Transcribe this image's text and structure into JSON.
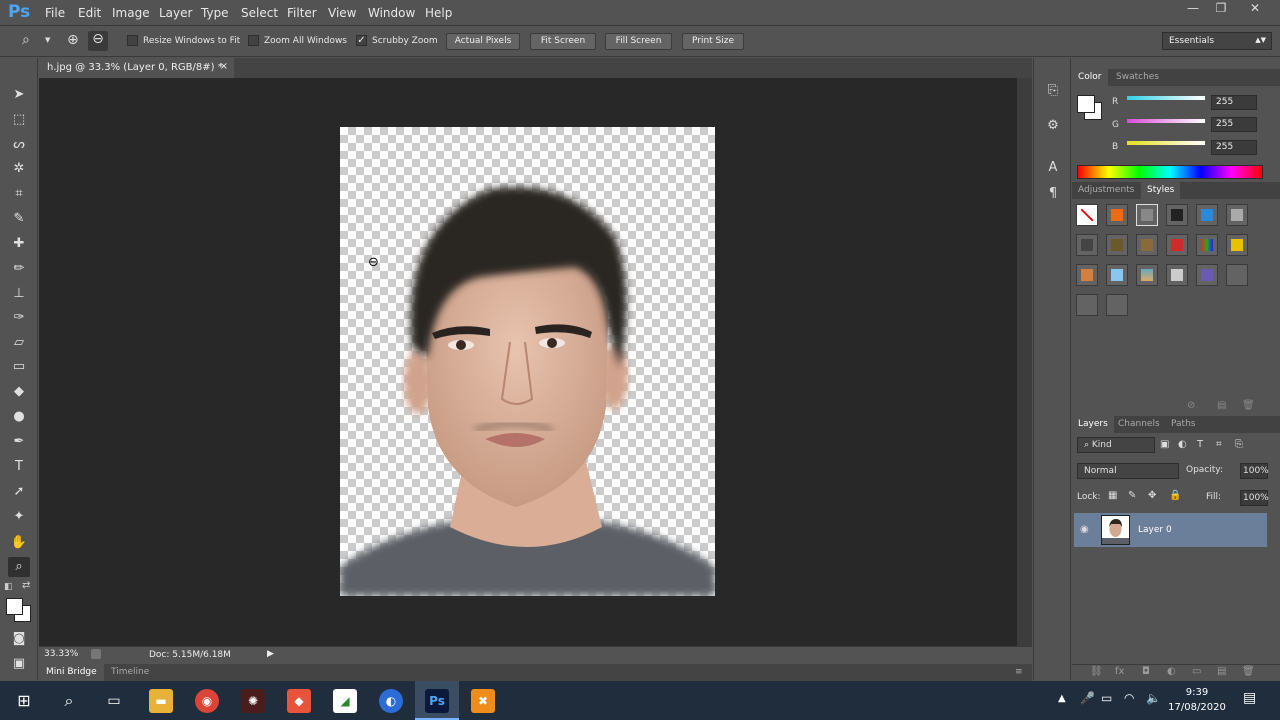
{
  "app": {
    "logo": "Ps"
  },
  "menu": [
    "File",
    "Edit",
    "Image",
    "Layer",
    "Type",
    "Select",
    "Filter",
    "View",
    "Window",
    "Help"
  ],
  "window_controls": {
    "minimize": "—",
    "restore": "❐",
    "close": "✕"
  },
  "options_bar": {
    "resize_windows_label": "Resize Windows to Fit",
    "resize_windows_checked": false,
    "zoom_all_label": "Zoom All Windows",
    "zoom_all_checked": false,
    "scrubby_zoom_label": "Scrubby Zoom",
    "scrubby_zoom_checked": true,
    "actual_pixels": "Actual Pixels",
    "fit_screen": "Fit Screen",
    "fill_screen": "Fill Screen",
    "print_size": "Print Size",
    "workspace": "Essentials"
  },
  "document": {
    "tab_title": "h.jpg @ 33.3% (Layer 0, RGB/8#) *",
    "close": "×",
    "zoom": "33.33%",
    "doc_info": "Doc: 5.15M/6.18M"
  },
  "bottom_tabs": [
    "Mini Bridge",
    "Timeline"
  ],
  "color_panel": {
    "tabs": [
      "Color",
      "Swatches"
    ],
    "channels": [
      {
        "label": "R",
        "value": "255",
        "color": "#3ad1e6"
      },
      {
        "label": "G",
        "value": "255",
        "color": "#d64ed6"
      },
      {
        "label": "B",
        "value": "255",
        "color": "#e6e020"
      }
    ]
  },
  "styles_panel": {
    "tabs": [
      "Adjustments",
      "Styles"
    ]
  },
  "layers_panel": {
    "tabs": [
      "Layers",
      "Channels",
      "Paths"
    ],
    "kind_label": "Kind",
    "blend_mode": "Normal",
    "opacity_label": "Opacity:",
    "opacity_value": "100%",
    "lock_label": "Lock:",
    "fill_label": "Fill:",
    "fill_value": "100%",
    "layers": [
      {
        "name": "Layer 0"
      }
    ]
  },
  "taskbar": {
    "time": "9:39",
    "date": "17/08/2020"
  }
}
